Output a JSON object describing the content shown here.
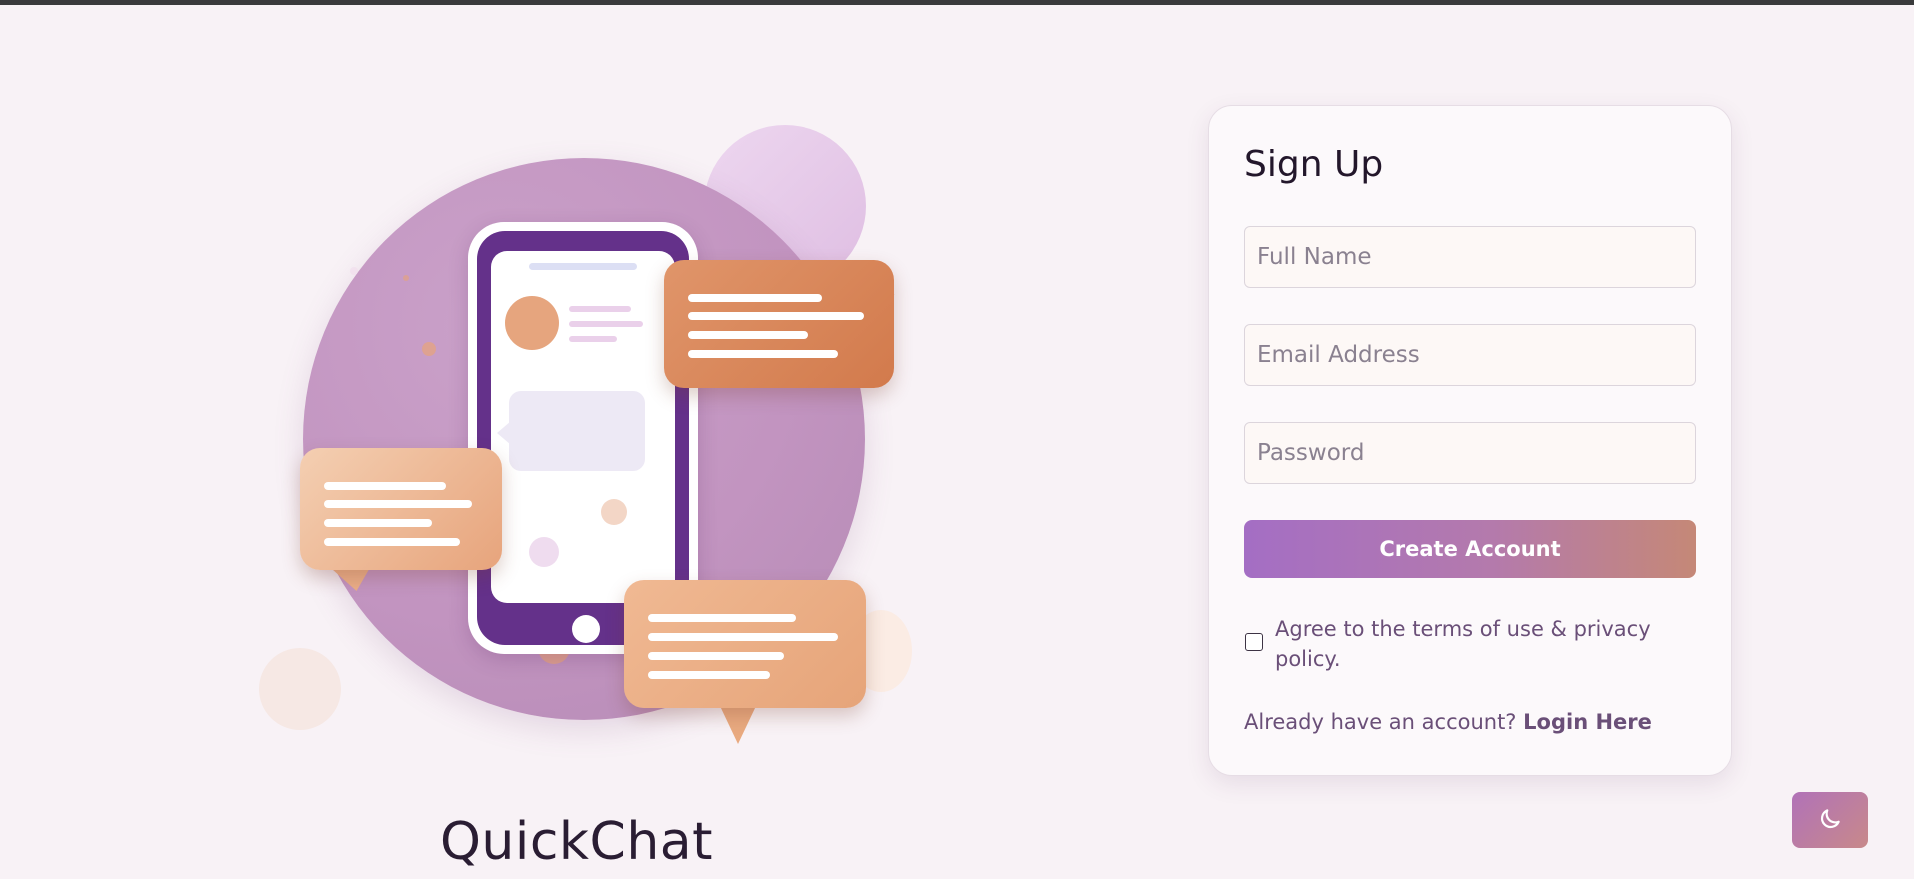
{
  "brand": {
    "name": "QuickChat"
  },
  "signup": {
    "title": "Sign Up",
    "fields": {
      "full_name_placeholder": "Full Name",
      "email_placeholder": "Email Address",
      "password_placeholder": "Password"
    },
    "submit_label": "Create Account",
    "terms_label": "Agree to the terms of use & privacy policy.",
    "terms_checked": false,
    "login_prompt": "Already have an account?",
    "login_link": "Login Here"
  },
  "theme_toggle": {
    "icon": "moon-icon"
  },
  "colors": {
    "background": "#f8f2f6",
    "accent_purple": "#a46ec4",
    "accent_peach": "#c58877",
    "phone_purple": "#64318a",
    "bubble_orange": "#d27a4c"
  }
}
